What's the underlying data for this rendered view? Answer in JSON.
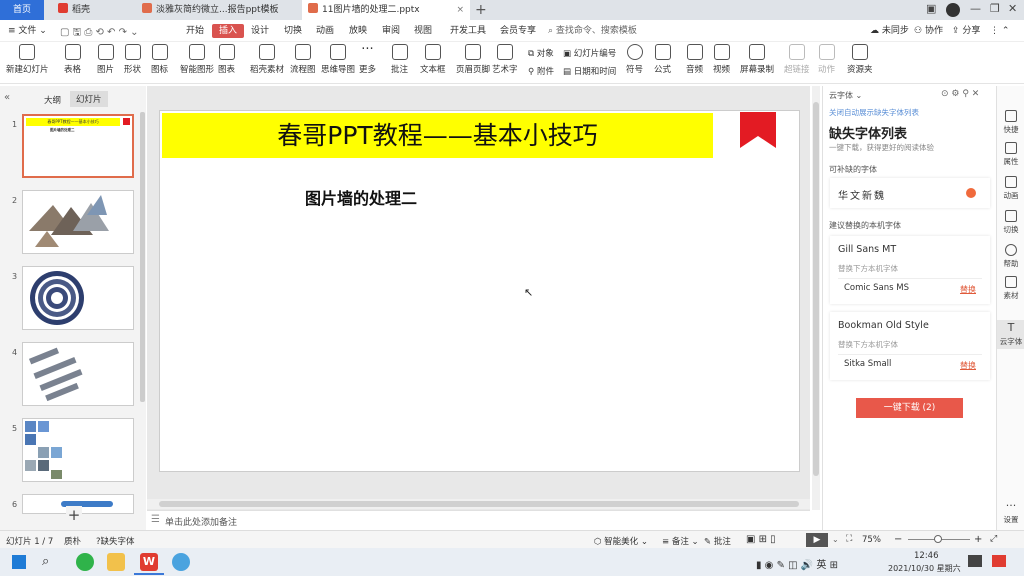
{
  "tabs": {
    "home": "首页",
    "t1": "稻壳",
    "t2": "淡雅灰简约微立...报告ppt模板",
    "t3": "11图片墙的处理二.pptx"
  },
  "menu": {
    "file": "文件",
    "items": [
      "开始",
      "插入",
      "设计",
      "切换",
      "动画",
      "放映",
      "审阅",
      "视图",
      "开发工具",
      "会员专享"
    ],
    "search": "查找命令、搜索模板",
    "sync": "未同步",
    "collab": "协作",
    "share": "分享"
  },
  "ribbon": [
    "新建幻灯片",
    "表格",
    "图片",
    "形状",
    "图标",
    "智能图形",
    "图表",
    "稻壳素材",
    "流程图",
    "思维导图",
    "更多",
    "批注",
    "文本框",
    "页眉页脚",
    "艺术字",
    "符号",
    "公式",
    "音频",
    "视频",
    "屏幕录制",
    "超链接",
    "动作",
    "资源夹"
  ],
  "ribbon_small": {
    "obj": "对象",
    "slidenum": "幻灯片编号",
    "attach": "附件",
    "datetime": "日期和时间"
  },
  "sidepanel": {
    "tab1": "大纲",
    "tab2": "幻灯片",
    "thumb1_title": "春哥PPT教程——基本小技巧",
    "thumb1_sub": "图片墙的处理二"
  },
  "slide": {
    "title": "春哥PPT教程——基本小技巧",
    "subtitle": "图片墙的处理二",
    "notes": "单击此处添加备注"
  },
  "fontpanel": {
    "header": "云字体",
    "link": "关闭自动展示缺失字体列表",
    "title": "缺失字体列表",
    "desc": "一键下载，获得更好的阅读体验",
    "sec1": "可补缺的字体",
    "font1": "华文新魏",
    "sec2": "建议替换的本机字体",
    "font2": "Gill Sans MT",
    "replace_hint": "替换下方本机字体",
    "font2r": "Comic Sans MS",
    "replace": "替换",
    "font3": "Bookman Old Style",
    "font3r": "Sitka Small",
    "download": "一键下载 (2)"
  },
  "vbar": [
    "快捷",
    "属性",
    "动画",
    "切换",
    "帮助",
    "素材",
    "云字体",
    "设置"
  ],
  "status": {
    "slide": "幻灯片 1 / 7",
    "theme": "质朴",
    "missing": "缺失字体",
    "beautify": "智能美化",
    "notes": "备注",
    "comment": "批注",
    "zoom": "75%"
  },
  "taskbar": {
    "time": "12:46",
    "date": "2021/10/30 星期六",
    "lang": "英"
  },
  "colors": {
    "accent": "#d9534f",
    "blue": "#2f6fd8",
    "yellow": "#ffff00",
    "ribbon": "#e31b23"
  }
}
